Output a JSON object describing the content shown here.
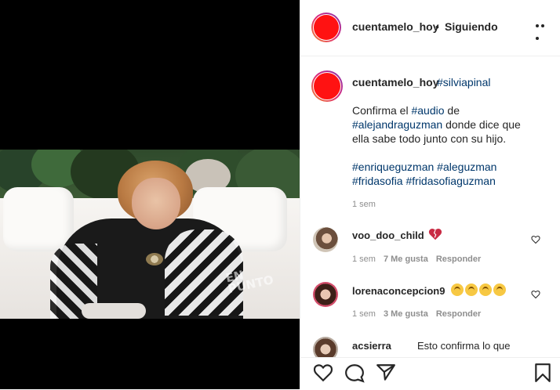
{
  "post": {
    "username": "cuentamelo_hoy",
    "follow_separator": "•",
    "follow_status": "Siguiendo",
    "caption": {
      "hashtag": "#silviapinal",
      "line1_prefix": "Confirma el ",
      "audio_tag": "#audio",
      "line1_suffix": " de",
      "alejandra_tag": "#alejandraguzman",
      "line2_suffix": " donde dice que",
      "line3": "ella sabe todo junto con su hijo.",
      "tags_line1": "#enriqueguzman #aleguzman",
      "tags_line2": "#fridasofia #fridasofiaguzman",
      "time": "1 sem"
    },
    "watermark": "EN PUNTO"
  },
  "comments": [
    {
      "username": "voo_doo_child",
      "text": "💔",
      "time": "1 sem",
      "likes": "7 Me gusta",
      "reply": "Responder"
    },
    {
      "username": "lorenaconcepcion9",
      "text": "😢😢😢😢",
      "time": "1 sem",
      "likes": "3 Me gusta",
      "reply": "Responder"
    },
    {
      "username": "acsierra",
      "text": "Esto confirma lo que"
    }
  ],
  "icons": {
    "more": "more-options-icon",
    "like": "heart-icon",
    "comment": "comment-icon",
    "share": "share-icon",
    "save": "bookmark-icon"
  },
  "colors": {
    "avatar_red": "#ff1212",
    "hashtag_blue": "#00376b",
    "muted_gray": "#8e8e8e",
    "broken_heart": "#c92b44"
  }
}
